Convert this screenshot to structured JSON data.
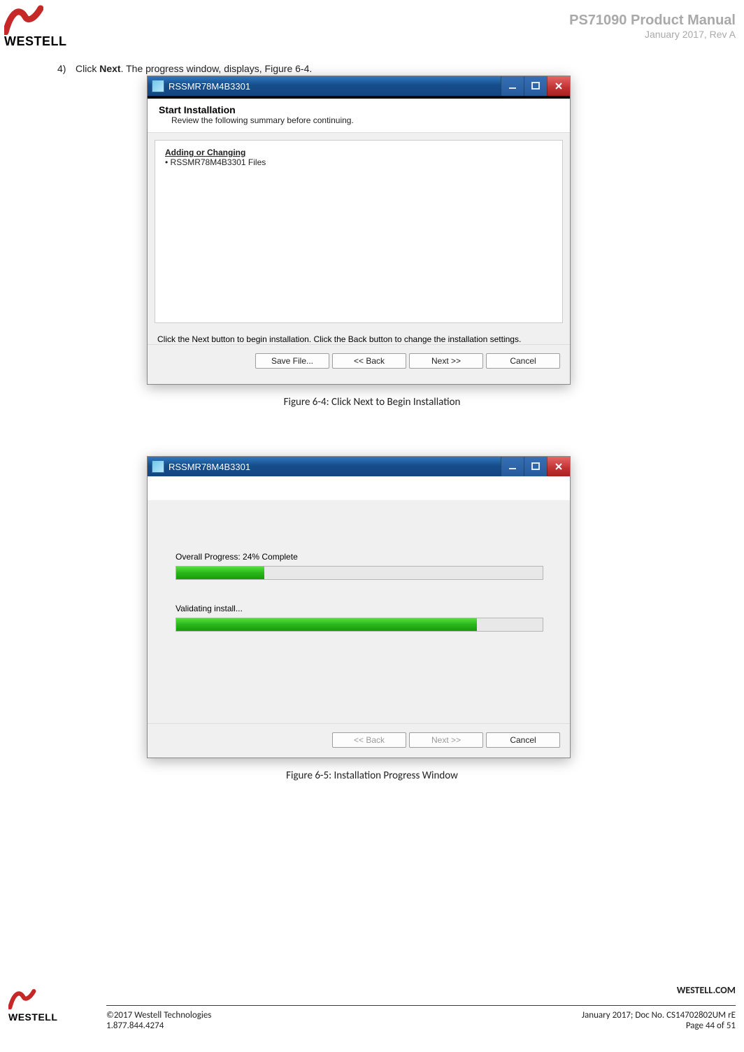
{
  "header": {
    "product_line": "PS71090 Product Manual",
    "rev_line": "January 2017, Rev A",
    "brand": "WESTELL"
  },
  "step": {
    "number": "4)",
    "text_before": "Click ",
    "bold": "Next",
    "text_after": ". The progress window, displays, Figure 6-4."
  },
  "dialog1": {
    "title": "RSSMR78M4B3301",
    "section_title": "Start Installation",
    "section_sub": "Review the following summary before continuing.",
    "summary_heading": "Adding or Changing",
    "summary_item": "• RSSMR78M4B3301 Files",
    "help": "Click the Next button to begin installation.  Click the Back button to change the installation settings.",
    "buttons": {
      "save": "Save File...",
      "back": "<< Back",
      "next": "Next >>",
      "cancel": "Cancel"
    }
  },
  "caption1": "Figure 6-4: Click Next to Begin Installation",
  "dialog2": {
    "title": "RSSMR78M4B3301",
    "overall_label": "Overall Progress: 24% Complete",
    "overall_pct": 24,
    "task_label": "Validating install...",
    "task_pct": 82,
    "buttons": {
      "back": "<< Back",
      "next": "Next >>",
      "cancel": "Cancel"
    }
  },
  "caption2": "Figure 6-5: Installation Progress Window",
  "footer": {
    "site": "WESTELL.COM",
    "copyright": "©2017 Westell Technologies",
    "docline": "January 2017; Doc No. CS14702802UM rE",
    "phone": "1.877.844.4274",
    "pages": "Page 44 of 51",
    "brand": "WESTELL"
  }
}
